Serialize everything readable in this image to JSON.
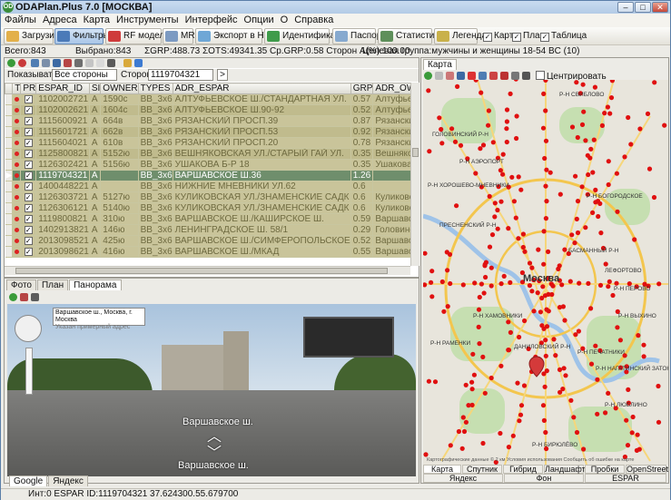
{
  "app": {
    "title": "ODAPlan.Plus 7.0 [МОСКВА]",
    "logo_text": "OD"
  },
  "menu": [
    "Файлы",
    "Адреса",
    "Карта",
    "Инструменты",
    "Интерфейс",
    "Опции",
    "О",
    "Справка"
  ],
  "toolbar": {
    "load": "Загрузить",
    "filters": "Фильтры",
    "rf": "RF модель",
    "mrf": "MRF",
    "export": "Экспорт в HTML",
    "ident": "Идентификация",
    "passport": "Паспорт",
    "stats": "Статистика",
    "legend": "Легенда",
    "cb_map": "Карта",
    "cb_plan": "План",
    "cb_table": "Таблица"
  },
  "summary": {
    "total": "Всего:843",
    "selected": "Выбрано:843",
    "grp": "ΣGRP:488.73 ΣOTS:49341.35 Ср.GRP:0.58 Сторон А(%):100.00",
    "target": "Целевая группа:мужчины и женщины 18-54 BC (10)"
  },
  "filter": {
    "show_label": "Показывать:",
    "show_value": "Все стороны",
    "side_label": "Сторона:",
    "side_value": "1119704321",
    "go": ">"
  },
  "table": {
    "columns": [
      "",
      "PR",
      "ESPAR_ID",
      "SI",
      "OWNER",
      "TYPES",
      "ADR_ESPAR",
      "GRP",
      "ADR_OWNER"
    ],
    "rows": [
      {
        "mark": "",
        "id": "1102002721",
        "si": "A",
        "owner": "1590с",
        "type": "BB_3x6",
        "adr": "АЛТУФЬЕВСКОЕ Ш./СТАНДАРТНАЯ УЛ.",
        "grp": "0.57",
        "own": "Алтуфьевское шоссе 60,"
      },
      {
        "mark": "",
        "id": "1102002621",
        "si": "A",
        "owner": "1604с",
        "type": "BB_3x6",
        "adr": "АЛТУФЬЕВСКОЕ Ш.90-92",
        "grp": "0.52",
        "own": "Алтуфьевское шоссе 92,"
      },
      {
        "mark": "",
        "id": "1115600921",
        "si": "A",
        "owner": "664в",
        "type": "BB_3x6",
        "adr": "РЯЗАНСКИЙ ПРОСП.39",
        "grp": "0.87",
        "own": "Рязанский просп. 41/2, -"
      },
      {
        "mark": "",
        "id": "1115601721",
        "si": "A",
        "owner": "662в",
        "type": "BB_3x6",
        "adr": "РЯЗАНСКИЙ ПРОСП.53",
        "grp": "0.92",
        "own": "Рязанский просп. 51, -"
      },
      {
        "mark": "",
        "id": "1115604021",
        "si": "A",
        "owner": "610в",
        "type": "BB_3x6",
        "adr": "РЯЗАНСКИЙ ПРОСП.20",
        "grp": "0.78",
        "own": "Рязанский пр. Д. 20 ст"
      },
      {
        "mark": "",
        "id": "1125800821",
        "si": "A",
        "owner": "5152ю",
        "type": "BB_3x6",
        "adr": "ВЕШНЯКОВСКАЯ УЛ./СТАРЫЙ ГАЙ УЛ.",
        "grp": "0.35",
        "own": "Вешняковская ул. 9 к.2, -"
      },
      {
        "mark": "",
        "id": "1126302421",
        "si": "A",
        "owner": "5156ю",
        "type": "BB_3x6",
        "adr": "УШАКОВА Б-Р 18",
        "grp": "0.35",
        "own": "Ушакова Адмирала буль."
      },
      {
        "mark": "▶",
        "id": "1119704321",
        "si": "A",
        "owner": "",
        "type": "BB_3x6",
        "adr": "ВАРШАВСКОЕ Ш.36",
        "grp": "1.26",
        "own": "",
        "sel": true
      },
      {
        "mark": "",
        "id": "1400448221",
        "si": "A",
        "owner": "",
        "type": "BB_3x6",
        "adr": "НИЖНИЕ МНЕВНИКИ УЛ.62",
        "grp": "0.6",
        "own": ""
      },
      {
        "mark": "",
        "id": "1126303721",
        "si": "A",
        "owner": "5127ю",
        "type": "BB_3x6",
        "adr": "КУЛИКОВСКАЯ УЛ./ЗНАМЕНСКИЕ САДК",
        "grp": "0.6",
        "own": "Куликовская ул. в.4, Полян"
      },
      {
        "mark": "",
        "id": "1126306121",
        "si": "A",
        "owner": "5140ю",
        "type": "BB_3x6",
        "adr": "КУЛИКОВСКАЯ УЛ./ЗНАМЕНСКИЕ САДК",
        "grp": "0.6",
        "own": "Куликовская ул. в.2 с.2, 70 м"
      },
      {
        "mark": "",
        "id": "1119800821",
        "si": "A",
        "owner": "310ю",
        "type": "BB_3x6",
        "adr": "ВАРШАВСКОЕ Ш./КАШИРСКОЕ Ш.",
        "grp": "0.59",
        "own": "Варшавское шоссе, д.46 р"
      },
      {
        "mark": "",
        "id": "1402913821",
        "si": "A",
        "owner": "146ю",
        "type": "BB_3x6",
        "adr": "ЛЕНИНГРАДСКОЕ Ш. 58/1",
        "grp": "0.29",
        "own": "Головинское шоссе 3, -"
      },
      {
        "mark": "",
        "id": "2013098521",
        "si": "A",
        "owner": "425ю",
        "type": "BB_3x6",
        "adr": "ВАРШАВСКОЕ Ш./СИМФЕРОПОЛЬСКОЕ",
        "grp": "0.52",
        "own": "Варшавское шоссе, чет.ст"
      },
      {
        "mark": "",
        "id": "2013098621",
        "si": "A",
        "owner": "416ю",
        "type": "BB_3x6",
        "adr": "ВАРШАВСКОЕ Ш./МКАД",
        "grp": "0.55",
        "own": "Варшавское шоссе, вл. 17"
      }
    ]
  },
  "bottom_tabs": [
    "Фото",
    "План",
    "Панорама"
  ],
  "pano": {
    "addr1": "Варшавское ш., Москва, г. Москва",
    "addr2": "Указан примерный адрес",
    "street1": "Варшавское ш.",
    "street2": "Варшавское ш.",
    "tabs": [
      "Google",
      "Яндекс"
    ]
  },
  "map": {
    "tab": "Карта",
    "center_label": "Центрировать",
    "city": "Москва",
    "districts": [
      "Р-Н СВИБЛОВО",
      "ГОЛОВИНСКИЙ Р-Н",
      "Р-Н ХОРОШЕВО-МНЕВНИКИ",
      "ПРЕСНЕНСКИЙ Р-Н",
      "БАСМАННЫЙ Р-Н",
      "Р-Н ПЕРОВО",
      "Р-Н ХАМОВНИКИ",
      "Р-Н РАМЕНКИ",
      "ДАНИЛОВСКИЙ Р-Н",
      "Р-Н ПЕЧАТНИКИ",
      "Р-Н НАГАТИНСКИЙ ЗАТОН",
      "Р-Н БОГОРОДСКОЕ",
      "Р-Н ВЫХИНО",
      "ЛЕФОРТОВО",
      "Р-Н АЭРОПОРТ",
      "Р-Н ЛЮБЛИНО",
      "Р-Н БИРЮЛЁВО"
    ],
    "attrib": "Картографические данные © 2 км Условия использования Сообщить об ошибке на карте",
    "tabs1": [
      "Карта",
      "Спутник",
      "Гибрид",
      "Ландшафт",
      "Пробки",
      "OpenStreet"
    ],
    "tabs2": [
      "Яндекс",
      "Фон",
      "ESPAR"
    ]
  },
  "status": {
    "text": "Инт:0  ESPAR ID:1119704321 37.624300.55.679700"
  }
}
